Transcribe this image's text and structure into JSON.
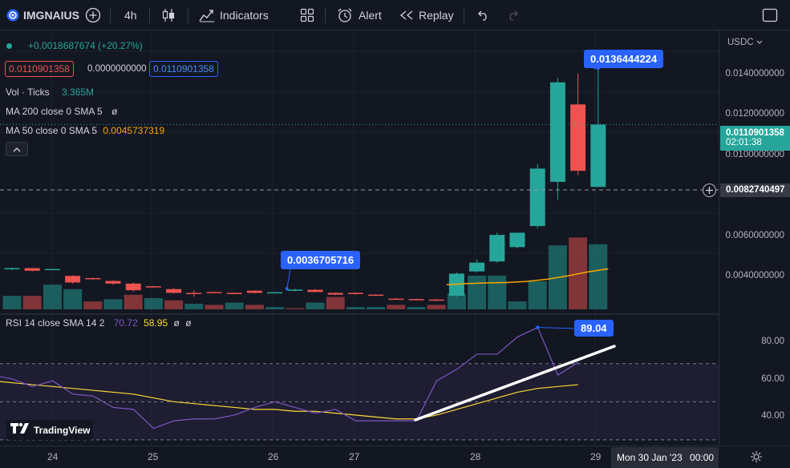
{
  "toolbar": {
    "symbol": "IMGNAIUS",
    "interval": "4h",
    "indicators_label": "Indicators",
    "alert_label": "Alert",
    "replay_label": "Replay"
  },
  "legend": {
    "change": "+0.0018687674 (+20.27%)",
    "bid": "0.0110901358",
    "spread": "0.0000000000",
    "ask": "0.0110901358",
    "vol_label": "Vol · Ticks",
    "vol_value": "3.365M",
    "ma200_label": "MA 200 close 0 SMA 5",
    "ma200_value": "ø",
    "ma50_label": "MA 50 close 0 SMA 5",
    "ma50_value": "0.0045737319",
    "rsi_label": "RSI 14 close SMA 14 2",
    "rsi_value": "70.72",
    "rsi_ma_value": "58.95",
    "rsi_extra1": "ø",
    "rsi_extra2": "ø"
  },
  "callouts": {
    "high": "0.0136444224",
    "low": "0.0036705716",
    "rsi_peak": "89.04"
  },
  "price_axis": {
    "currency": "USDC",
    "ticks": [
      "0.0140000000",
      "0.0120000000",
      "0.0100000000",
      "0.0060000000",
      "0.0040000000"
    ],
    "last_price": "0.0110901358",
    "countdown": "02:01:38",
    "crosshair_price": "0.0082740497"
  },
  "rsi_axis": {
    "ticks": [
      "80.00",
      "60.00",
      "40.00"
    ]
  },
  "time_axis": {
    "ticks": [
      "24",
      "25",
      "26",
      "27",
      "28",
      "29"
    ],
    "crosshair_date": "Mon 30 Jan '23",
    "crosshair_time": "00:00"
  },
  "watermark": "TradingView",
  "colors": {
    "bg": "#131722",
    "up": "#26a69a",
    "down": "#ef5350",
    "ma50": "#f7a600",
    "rsi": "#7e57c2",
    "rsi_ma": "#fdd835",
    "accent": "#2962ff"
  },
  "chart_data": {
    "type": "candlestick",
    "price_ylim": [
      0.0027,
      0.0152
    ],
    "candles": [
      {
        "o": 0.00455,
        "h": 0.00462,
        "l": 0.0045,
        "c": 0.0046
      },
      {
        "o": 0.0046,
        "h": 0.0046,
        "l": 0.00445,
        "c": 0.00448
      },
      {
        "o": 0.00455,
        "h": 0.00458,
        "l": 0.00452,
        "c": 0.00456
      },
      {
        "o": 0.00425,
        "h": 0.00428,
        "l": 0.0039,
        "c": 0.00395
      },
      {
        "o": 0.00415,
        "h": 0.00418,
        "l": 0.00408,
        "c": 0.00412
      },
      {
        "o": 0.00402,
        "h": 0.00404,
        "l": 0.00385,
        "c": 0.0039
      },
      {
        "o": 0.0039,
        "h": 0.00395,
        "l": 0.00355,
        "c": 0.0036
      },
      {
        "o": 0.00378,
        "h": 0.0038,
        "l": 0.00372,
        "c": 0.00375
      },
      {
        "o": 0.00365,
        "h": 0.0037,
        "l": 0.00345,
        "c": 0.00348
      },
      {
        "o": 0.00348,
        "h": 0.0036,
        "l": 0.0033,
        "c": 0.00345
      },
      {
        "o": 0.00352,
        "h": 0.00354,
        "l": 0.00348,
        "c": 0.0035
      },
      {
        "o": 0.00348,
        "h": 0.0035,
        "l": 0.00342,
        "c": 0.00345
      },
      {
        "o": 0.00358,
        "h": 0.0036,
        "l": 0.00345,
        "c": 0.00348
      },
      {
        "o": 0.0035,
        "h": 0.00352,
        "l": 0.00347,
        "c": 0.00351
      },
      {
        "o": 0.0036,
        "h": 0.00367,
        "l": 0.00355,
        "c": 0.00363
      },
      {
        "o": 0.00362,
        "h": 0.00365,
        "l": 0.0035,
        "c": 0.00352
      },
      {
        "o": 0.00348,
        "h": 0.0035,
        "l": 0.00338,
        "c": 0.0034
      },
      {
        "o": 0.00348,
        "h": 0.0035,
        "l": 0.0034,
        "c": 0.00343
      },
      {
        "o": 0.0034,
        "h": 0.00342,
        "l": 0.00335,
        "c": 0.00338
      },
      {
        "o": 0.00322,
        "h": 0.00325,
        "l": 0.00318,
        "c": 0.0032
      },
      {
        "o": 0.0032,
        "h": 0.00322,
        "l": 0.00315,
        "c": 0.00318
      },
      {
        "o": 0.00318,
        "h": 0.0032,
        "l": 0.00312,
        "c": 0.00316
      },
      {
        "o": 0.00335,
        "h": 0.0044,
        "l": 0.0033,
        "c": 0.00435
      },
      {
        "o": 0.00445,
        "h": 0.005,
        "l": 0.0044,
        "c": 0.00485
      },
      {
        "o": 0.0049,
        "h": 0.0062,
        "l": 0.00485,
        "c": 0.0061
      },
      {
        "o": 0.00555,
        "h": 0.0062,
        "l": 0.0055,
        "c": 0.0062
      },
      {
        "o": 0.0065,
        "h": 0.0093,
        "l": 0.0064,
        "c": 0.0091
      },
      {
        "o": 0.0085,
        "h": 0.0132,
        "l": 0.0077,
        "c": 0.013
      },
      {
        "o": 0.012,
        "h": 0.0134,
        "l": 0.0088,
        "c": 0.009
      },
      {
        "o": 0.00827,
        "h": 0.01364,
        "l": 0.00827,
        "c": 0.01109
      }
    ],
    "volume": [
      {
        "v": 0.12,
        "up": true
      },
      {
        "v": 0.12,
        "up": false
      },
      {
        "v": 0.22,
        "up": true
      },
      {
        "v": 0.18,
        "up": true
      },
      {
        "v": 0.07,
        "up": false
      },
      {
        "v": 0.09,
        "up": true
      },
      {
        "v": 0.13,
        "up": false
      },
      {
        "v": 0.1,
        "up": true
      },
      {
        "v": 0.08,
        "up": false
      },
      {
        "v": 0.05,
        "up": true
      },
      {
        "v": 0.04,
        "up": false
      },
      {
        "v": 0.06,
        "up": true
      },
      {
        "v": 0.04,
        "up": false
      },
      {
        "v": 0.02,
        "up": true
      },
      {
        "v": 0.01,
        "up": false
      },
      {
        "v": 0.06,
        "up": true
      },
      {
        "v": 0.11,
        "up": false
      },
      {
        "v": 0.02,
        "up": true
      },
      {
        "v": 0.02,
        "up": true
      },
      {
        "v": 0.04,
        "up": false
      },
      {
        "v": 0.02,
        "up": true
      },
      {
        "v": 0.04,
        "up": false
      },
      {
        "v": 0.14,
        "up": true
      },
      {
        "v": 0.3,
        "up": true
      },
      {
        "v": 0.3,
        "up": true
      },
      {
        "v": 0.07,
        "up": true
      },
      {
        "v": 0.25,
        "up": true
      },
      {
        "v": 0.57,
        "up": true
      },
      {
        "v": 0.64,
        "up": false
      },
      {
        "v": 0.58,
        "up": true
      }
    ],
    "ma50": [
      [
        22,
        0.00385
      ],
      [
        23,
        0.0039
      ],
      [
        24,
        0.00393
      ],
      [
        25,
        0.00395
      ],
      [
        26,
        0.004
      ],
      [
        27,
        0.0041
      ],
      [
        28,
        0.00425
      ],
      [
        29,
        0.00443
      ],
      [
        30,
        0.00457
      ]
    ],
    "rsi_ylim": [
      27,
      96
    ],
    "rsi": [
      64,
      62,
      58,
      61,
      54,
      53,
      47,
      46,
      36,
      40,
      41,
      41,
      43,
      47,
      50,
      47,
      44,
      46,
      40,
      40,
      40,
      40,
      61,
      67,
      75,
      75,
      84,
      89.04,
      64,
      70.72
    ],
    "rsi_ma": [
      61,
      60,
      59,
      58,
      57,
      56,
      55,
      54,
      52,
      50,
      49,
      48,
      47,
      46,
      46,
      45,
      45,
      44,
      43,
      42,
      41,
      41,
      43,
      46,
      49,
      52,
      55,
      57,
      58,
      58.95
    ],
    "rsi_bands": [
      70,
      50,
      30
    ],
    "x_ticks": [
      "24",
      "25",
      "26",
      "27",
      "28",
      "29"
    ]
  }
}
